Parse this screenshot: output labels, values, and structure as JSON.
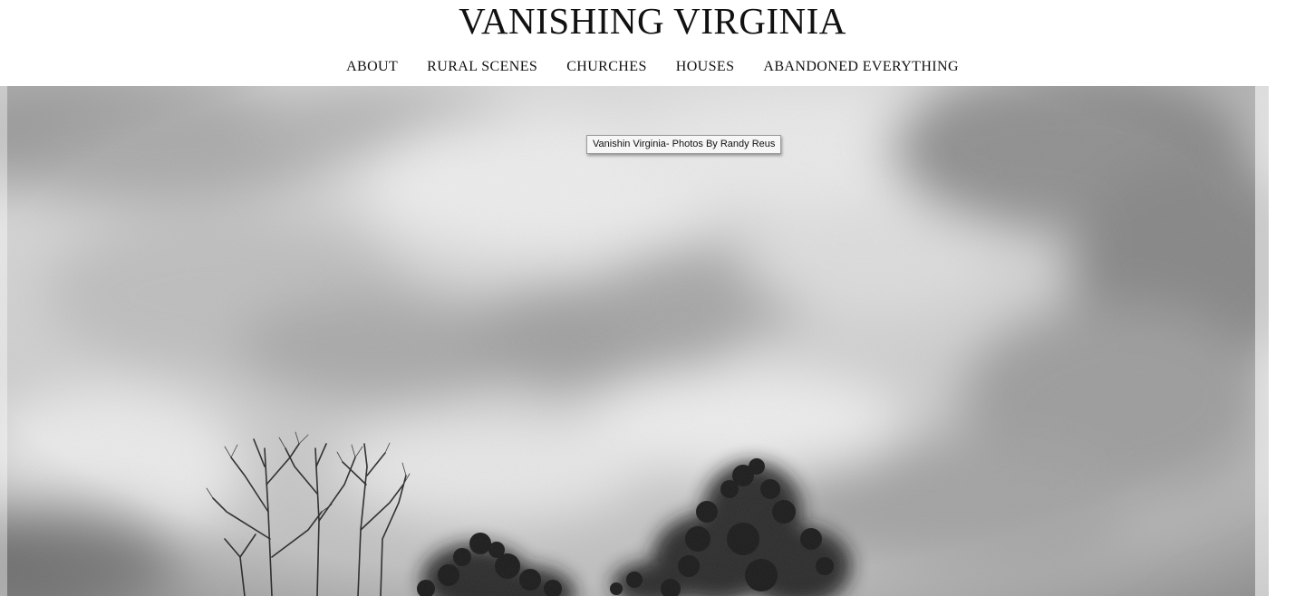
{
  "site": {
    "title": "VANISHING VIRGINIA"
  },
  "nav": {
    "items": [
      {
        "label": "ABOUT"
      },
      {
        "label": "RURAL SCENES"
      },
      {
        "label": "CHURCHES"
      },
      {
        "label": "HOUSES"
      },
      {
        "label": "ABANDONED EVERYTHING"
      }
    ]
  },
  "hero": {
    "tooltip": "Vanishin Virginia- Photos By Randy Reus",
    "style": "black-and-white photograph, cloudy sky over treetops"
  },
  "colors": {
    "text": "#111111",
    "background": "#ffffff",
    "sky_light": "#e4e4e4",
    "sky_dark": "#8c8c8c",
    "trees": "#1e1e1e"
  }
}
